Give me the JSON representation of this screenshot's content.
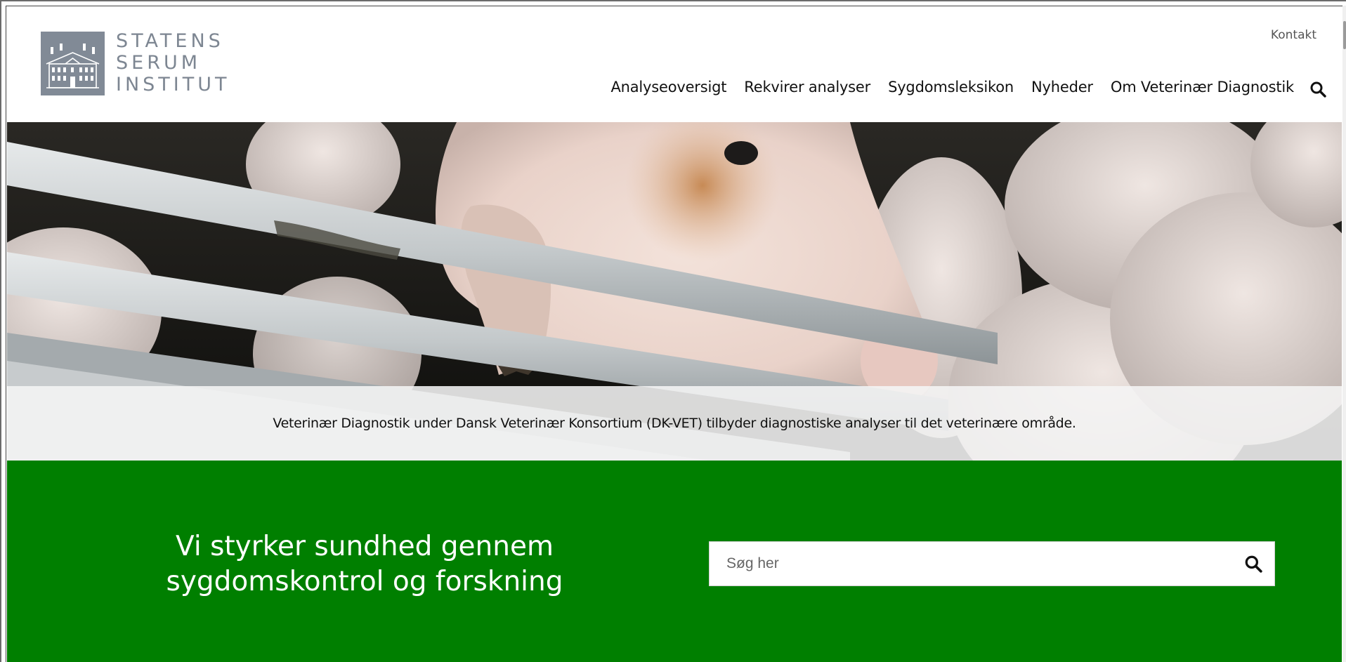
{
  "header": {
    "logo": {
      "line1": "STATENS",
      "line2": "SERUM",
      "line3": "INSTITUT",
      "mark_color": "#818a96"
    },
    "kontakt_label": "Kontakt",
    "nav": [
      {
        "label": "Analyseoversigt"
      },
      {
        "label": "Rekvirer analyser"
      },
      {
        "label": "Sygdomsleksikon"
      },
      {
        "label": "Nyheder"
      },
      {
        "label": "Om Veterinær Diagnostik"
      }
    ],
    "search_icon": "search-icon"
  },
  "hero": {
    "image": "pigs-in-pen-photo",
    "caption": "Veterinær Diagnostik under Dansk Veterinær Konsortium (DK-VET) tilbyder diagnostiske analyser til det veterinære område."
  },
  "promo": {
    "background": "#007f00",
    "tagline_line1": "Vi styrker sundhed gennem",
    "tagline_line2": "sygdomskontrol og forskning",
    "search": {
      "placeholder": "Søg her",
      "value": "",
      "button_icon": "search-icon"
    }
  }
}
